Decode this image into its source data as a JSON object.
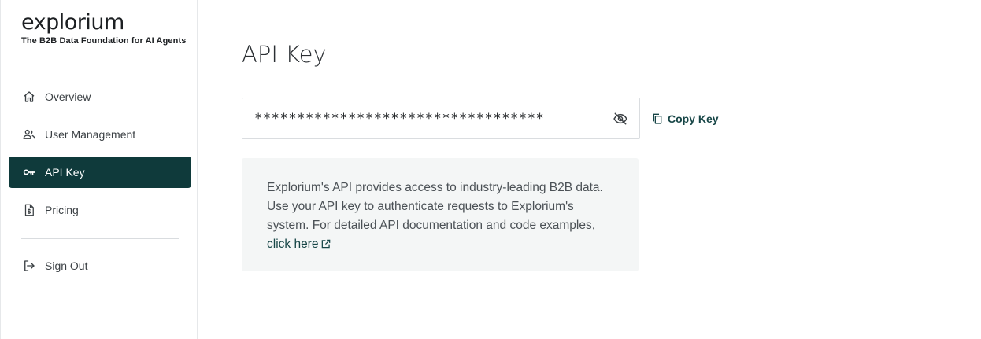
{
  "brand": {
    "logo": "explorium",
    "tagline": "The B2B Data Foundation for AI Agents"
  },
  "sidebar": {
    "items": [
      {
        "label": "Overview",
        "icon": "home-icon",
        "active": false
      },
      {
        "label": "User Management",
        "icon": "users-icon",
        "active": false
      },
      {
        "label": "API Key",
        "icon": "key-icon",
        "active": true
      },
      {
        "label": "Pricing",
        "icon": "pricing-document-icon",
        "active": false
      }
    ],
    "signout_label": "Sign Out",
    "signout_icon": "sign-out-icon",
    "active_color": "#0f3a3b"
  },
  "main": {
    "title": "API Key",
    "api_key_masked": "**********************************",
    "visibility_icon": "eye-off-icon",
    "copy_label": "Copy Key",
    "copy_icon": "copy-icon",
    "info_text": "Explorium's API provides access to industry-leading B2B data. Use your API key to authenticate requests to Explorium's system. For detailed API documentation and code examples, ",
    "info_link_label": "click here",
    "info_link_icon": "external-link-icon"
  }
}
